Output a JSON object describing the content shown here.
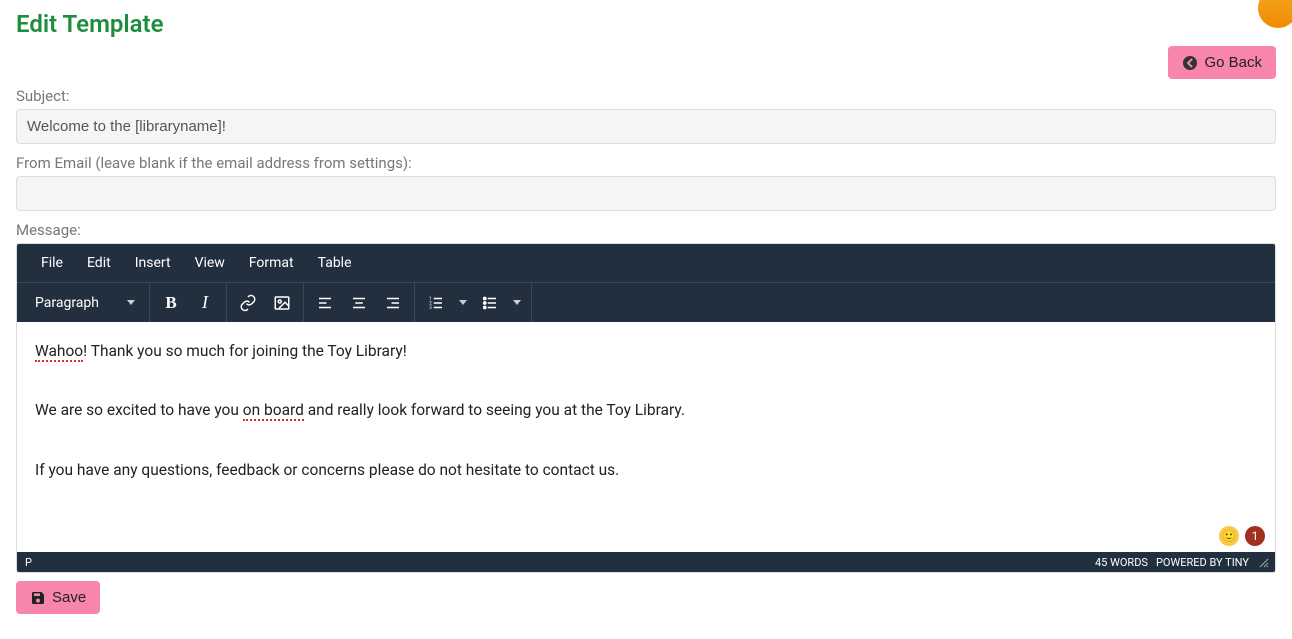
{
  "header": {
    "title": "Edit Template",
    "go_back_label": "Go Back"
  },
  "form": {
    "subject_label": "Subject:",
    "subject_value": "Welcome to the [libraryname]!",
    "from_email_label": "From Email (leave blank if the email address from settings):",
    "from_email_value": "",
    "message_label": "Message:"
  },
  "editor": {
    "menubar": [
      "File",
      "Edit",
      "Insert",
      "View",
      "Format",
      "Table"
    ],
    "format_select": "Paragraph",
    "body": {
      "p1_spell": "Wahoo",
      "p1_rest": "! Thank you so much for joining the Toy Library!",
      "p2_a": "We are so excited to have you ",
      "p2_spell": "on board",
      "p2_b": " and really look forward to seeing you at the Toy Library.",
      "p3": "If you have any questions, feedback or concerns please do not hesitate to contact us."
    },
    "status": {
      "path": "P",
      "word_count": "45 WORDS",
      "powered": "POWERED BY TINY"
    },
    "notification_count": "1"
  },
  "footer": {
    "save_label": "Save"
  }
}
